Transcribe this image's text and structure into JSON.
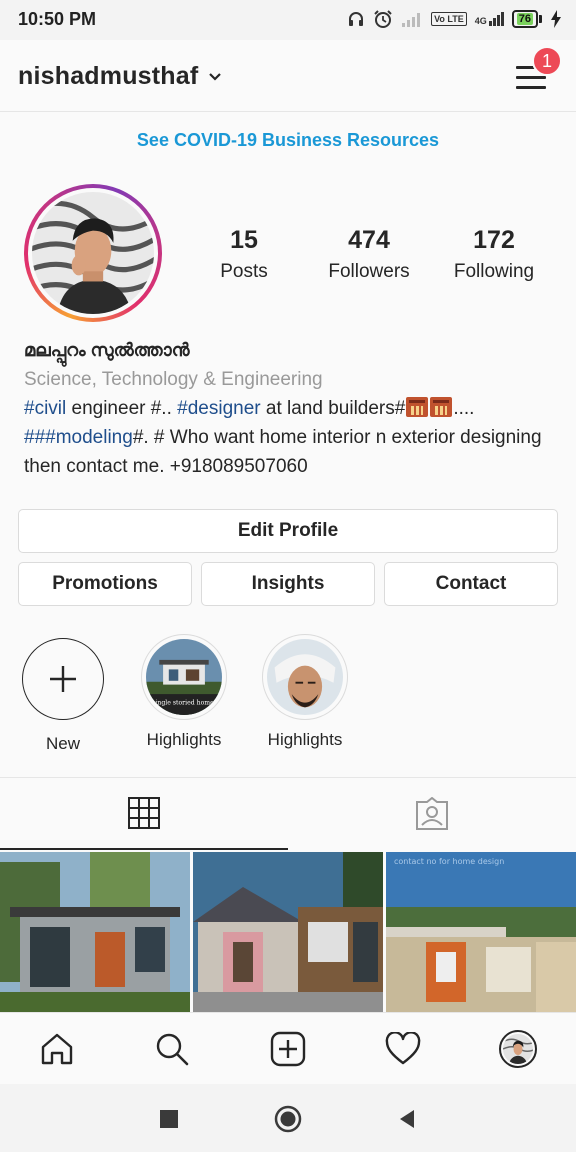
{
  "status_bar": {
    "time": "10:50 PM",
    "icons": [
      "headphones-icon",
      "alarm-icon",
      "signal-icon",
      "volte-icon",
      "4g-signal-icon"
    ],
    "volte_label": "Vo LTE",
    "network_label": "4G",
    "battery_level": "76"
  },
  "header": {
    "username": "nishadmusthaf",
    "chevron": "⌄",
    "notification_count": "1"
  },
  "covid_link": "See COVID-19 Business Resources",
  "profile": {
    "stats": [
      {
        "value": "15",
        "label": "Posts"
      },
      {
        "value": "474",
        "label": "Followers"
      },
      {
        "value": "172",
        "label": "Following"
      }
    ],
    "display_name": "മലപ്പുറം സുൽത്താൻ",
    "category": "Science, Technology & Engineering",
    "bio": {
      "t1": "#civil",
      "t2": " engineer #.. ",
      "t3": "#designer",
      "t4": " at land builders#",
      "t5": "....",
      "t6": "###modeling",
      "t7": "#.  # Who want home interior n exterior designing then contact me. +918089507060"
    }
  },
  "buttons": {
    "edit_profile": "Edit Profile",
    "promotions": "Promotions",
    "insights": "Insights",
    "contact": "Contact"
  },
  "highlights": [
    {
      "label": "New"
    },
    {
      "label": "Highlights",
      "caption": "single storied home."
    },
    {
      "label": "Highlights"
    }
  ],
  "tabs": [
    "grid-icon",
    "tagged-icon"
  ],
  "posts": [
    "post-1",
    "post-2",
    "post-3"
  ],
  "post_caption": "contact no for home design",
  "bottom_nav": [
    "home-icon",
    "search-icon",
    "add-post-icon",
    "heart-icon",
    "profile-avatar"
  ],
  "system_nav": [
    "recents-icon",
    "home-circle-icon",
    "back-icon"
  ],
  "colors": {
    "accent_link": "#1a98d6",
    "hashtag": "#1f4e8c",
    "badge": "#ed4956",
    "text": "#262626",
    "muted": "#999999"
  }
}
